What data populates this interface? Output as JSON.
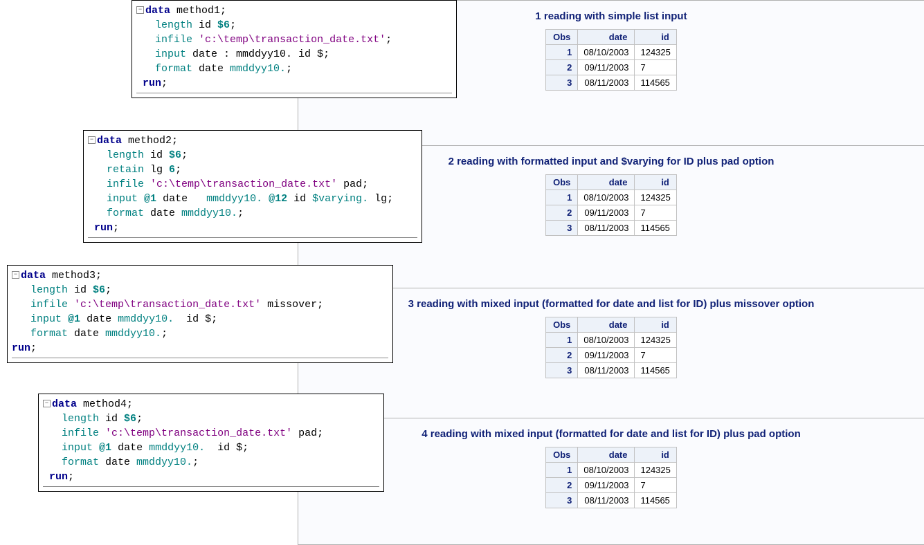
{
  "code_boxes": [
    {
      "lines": [
        [
          {
            "t": "minus"
          },
          {
            "cls": "kw",
            "txt": "data"
          },
          {
            "txt": " method1;"
          }
        ],
        [
          {
            "txt": "   "
          },
          {
            "cls": "opt",
            "txt": "length"
          },
          {
            "txt": " id "
          },
          {
            "cls": "num",
            "txt": "$6"
          },
          {
            "txt": ";"
          }
        ],
        [
          {
            "txt": "   "
          },
          {
            "cls": "opt",
            "txt": "infile"
          },
          {
            "txt": " "
          },
          {
            "cls": "str",
            "txt": "'c:\\temp\\transaction_date.txt'"
          },
          {
            "txt": ";"
          }
        ],
        [
          {
            "txt": "   "
          },
          {
            "cls": "opt",
            "txt": "input"
          },
          {
            "txt": " date : mmddyy10. id $;"
          }
        ],
        [
          {
            "txt": "   "
          },
          {
            "cls": "opt",
            "txt": "format"
          },
          {
            "txt": " date "
          },
          {
            "cls": "opt",
            "txt": "mmddyy10."
          },
          {
            "txt": ";"
          }
        ],
        [
          {
            "txt": " "
          },
          {
            "cls": "kw",
            "txt": "run"
          },
          {
            "txt": ";"
          }
        ]
      ]
    },
    {
      "lines": [
        [
          {
            "t": "minus"
          },
          {
            "cls": "kw",
            "txt": "data"
          },
          {
            "txt": " method2;"
          }
        ],
        [
          {
            "txt": "   "
          },
          {
            "cls": "opt",
            "txt": "length"
          },
          {
            "txt": " id "
          },
          {
            "cls": "num",
            "txt": "$6"
          },
          {
            "txt": ";"
          }
        ],
        [
          {
            "txt": "   "
          },
          {
            "cls": "opt",
            "txt": "retain"
          },
          {
            "txt": " lg "
          },
          {
            "cls": "num",
            "txt": "6"
          },
          {
            "txt": ";"
          }
        ],
        [
          {
            "txt": "   "
          },
          {
            "cls": "opt",
            "txt": "infile"
          },
          {
            "txt": " "
          },
          {
            "cls": "str",
            "txt": "'c:\\temp\\transaction_date.txt'"
          },
          {
            "txt": " pad;"
          }
        ],
        [
          {
            "txt": "   "
          },
          {
            "cls": "opt",
            "txt": "input"
          },
          {
            "txt": " "
          },
          {
            "cls": "num",
            "txt": "@1"
          },
          {
            "txt": " date   "
          },
          {
            "cls": "opt",
            "txt": "mmddyy10."
          },
          {
            "txt": " "
          },
          {
            "cls": "num",
            "txt": "@12"
          },
          {
            "txt": " id "
          },
          {
            "cls": "opt",
            "txt": "$varying."
          },
          {
            "txt": " lg;"
          }
        ],
        [
          {
            "txt": "   "
          },
          {
            "cls": "opt",
            "txt": "format"
          },
          {
            "txt": " date "
          },
          {
            "cls": "opt",
            "txt": "mmddyy10."
          },
          {
            "txt": ";"
          }
        ],
        [
          {
            "txt": " "
          },
          {
            "cls": "kw",
            "txt": "run"
          },
          {
            "txt": ";"
          }
        ]
      ]
    },
    {
      "lines": [
        [
          {
            "t": "minus"
          },
          {
            "cls": "kw",
            "txt": "data"
          },
          {
            "txt": " method3;"
          }
        ],
        [
          {
            "txt": "   "
          },
          {
            "cls": "opt",
            "txt": "length"
          },
          {
            "txt": " id "
          },
          {
            "cls": "num",
            "txt": "$6"
          },
          {
            "txt": ";"
          }
        ],
        [
          {
            "txt": "   "
          },
          {
            "cls": "opt",
            "txt": "infile"
          },
          {
            "txt": " "
          },
          {
            "cls": "str",
            "txt": "'c:\\temp\\transaction_date.txt'"
          },
          {
            "txt": " missover;"
          }
        ],
        [
          {
            "txt": "   "
          },
          {
            "cls": "opt",
            "txt": "input"
          },
          {
            "txt": " "
          },
          {
            "cls": "num",
            "txt": "@1"
          },
          {
            "txt": " date "
          },
          {
            "cls": "opt",
            "txt": "mmddyy10."
          },
          {
            "txt": "  id $;"
          }
        ],
        [
          {
            "txt": "   "
          },
          {
            "cls": "opt",
            "txt": "format"
          },
          {
            "txt": " date "
          },
          {
            "cls": "opt",
            "txt": "mmddyy10."
          },
          {
            "txt": ";"
          }
        ],
        [
          {
            "cls": "kw",
            "txt": "run"
          },
          {
            "txt": ";"
          }
        ]
      ]
    },
    {
      "lines": [
        [
          {
            "t": "minus"
          },
          {
            "cls": "kw",
            "txt": "data"
          },
          {
            "txt": " method4;"
          }
        ],
        [
          {
            "txt": "   "
          },
          {
            "cls": "opt",
            "txt": "length"
          },
          {
            "txt": " id "
          },
          {
            "cls": "num",
            "txt": "$6"
          },
          {
            "txt": ";"
          }
        ],
        [
          {
            "txt": "   "
          },
          {
            "cls": "opt",
            "txt": "infile"
          },
          {
            "txt": " "
          },
          {
            "cls": "str",
            "txt": "'c:\\temp\\transaction_date.txt'"
          },
          {
            "txt": " pad;"
          }
        ],
        [
          {
            "txt": "   "
          },
          {
            "cls": "opt",
            "txt": "input"
          },
          {
            "txt": " "
          },
          {
            "cls": "num",
            "txt": "@1"
          },
          {
            "txt": " date "
          },
          {
            "cls": "opt",
            "txt": "mmddyy10."
          },
          {
            "txt": "  id $;"
          }
        ],
        [
          {
            "txt": "   "
          },
          {
            "cls": "opt",
            "txt": "format"
          },
          {
            "txt": " date "
          },
          {
            "cls": "opt",
            "txt": "mmddyy10."
          },
          {
            "txt": ";"
          }
        ],
        [
          {
            "txt": " "
          },
          {
            "cls": "kw",
            "txt": "run"
          },
          {
            "txt": ";"
          }
        ]
      ]
    }
  ],
  "results": [
    {
      "title": "1 reading with simple list input",
      "headers": [
        "Obs",
        "date",
        "id"
      ],
      "rows": [
        [
          "1",
          "08/10/2003",
          "124325"
        ],
        [
          "2",
          "09/11/2003",
          "7"
        ],
        [
          "3",
          "08/11/2003",
          "114565"
        ]
      ]
    },
    {
      "title": "2 reading with formatted input and $varying for ID plus pad option",
      "headers": [
        "Obs",
        "date",
        "id"
      ],
      "rows": [
        [
          "1",
          "08/10/2003",
          "124325"
        ],
        [
          "2",
          "09/11/2003",
          "7"
        ],
        [
          "3",
          "08/11/2003",
          "114565"
        ]
      ]
    },
    {
      "title": "3 reading with mixed input (formatted for date and list for ID) plus missover option",
      "headers": [
        "Obs",
        "date",
        "id"
      ],
      "rows": [
        [
          "1",
          "08/10/2003",
          "124325"
        ],
        [
          "2",
          "09/11/2003",
          "7"
        ],
        [
          "3",
          "08/11/2003",
          "114565"
        ]
      ]
    },
    {
      "title": "4 reading with mixed input (formatted for date and list for ID) plus pad option",
      "headers": [
        "Obs",
        "date",
        "id"
      ],
      "rows": [
        [
          "1",
          "08/10/2003",
          "124325"
        ],
        [
          "2",
          "09/11/2003",
          "7"
        ],
        [
          "3",
          "08/11/2003",
          "114565"
        ]
      ]
    }
  ]
}
